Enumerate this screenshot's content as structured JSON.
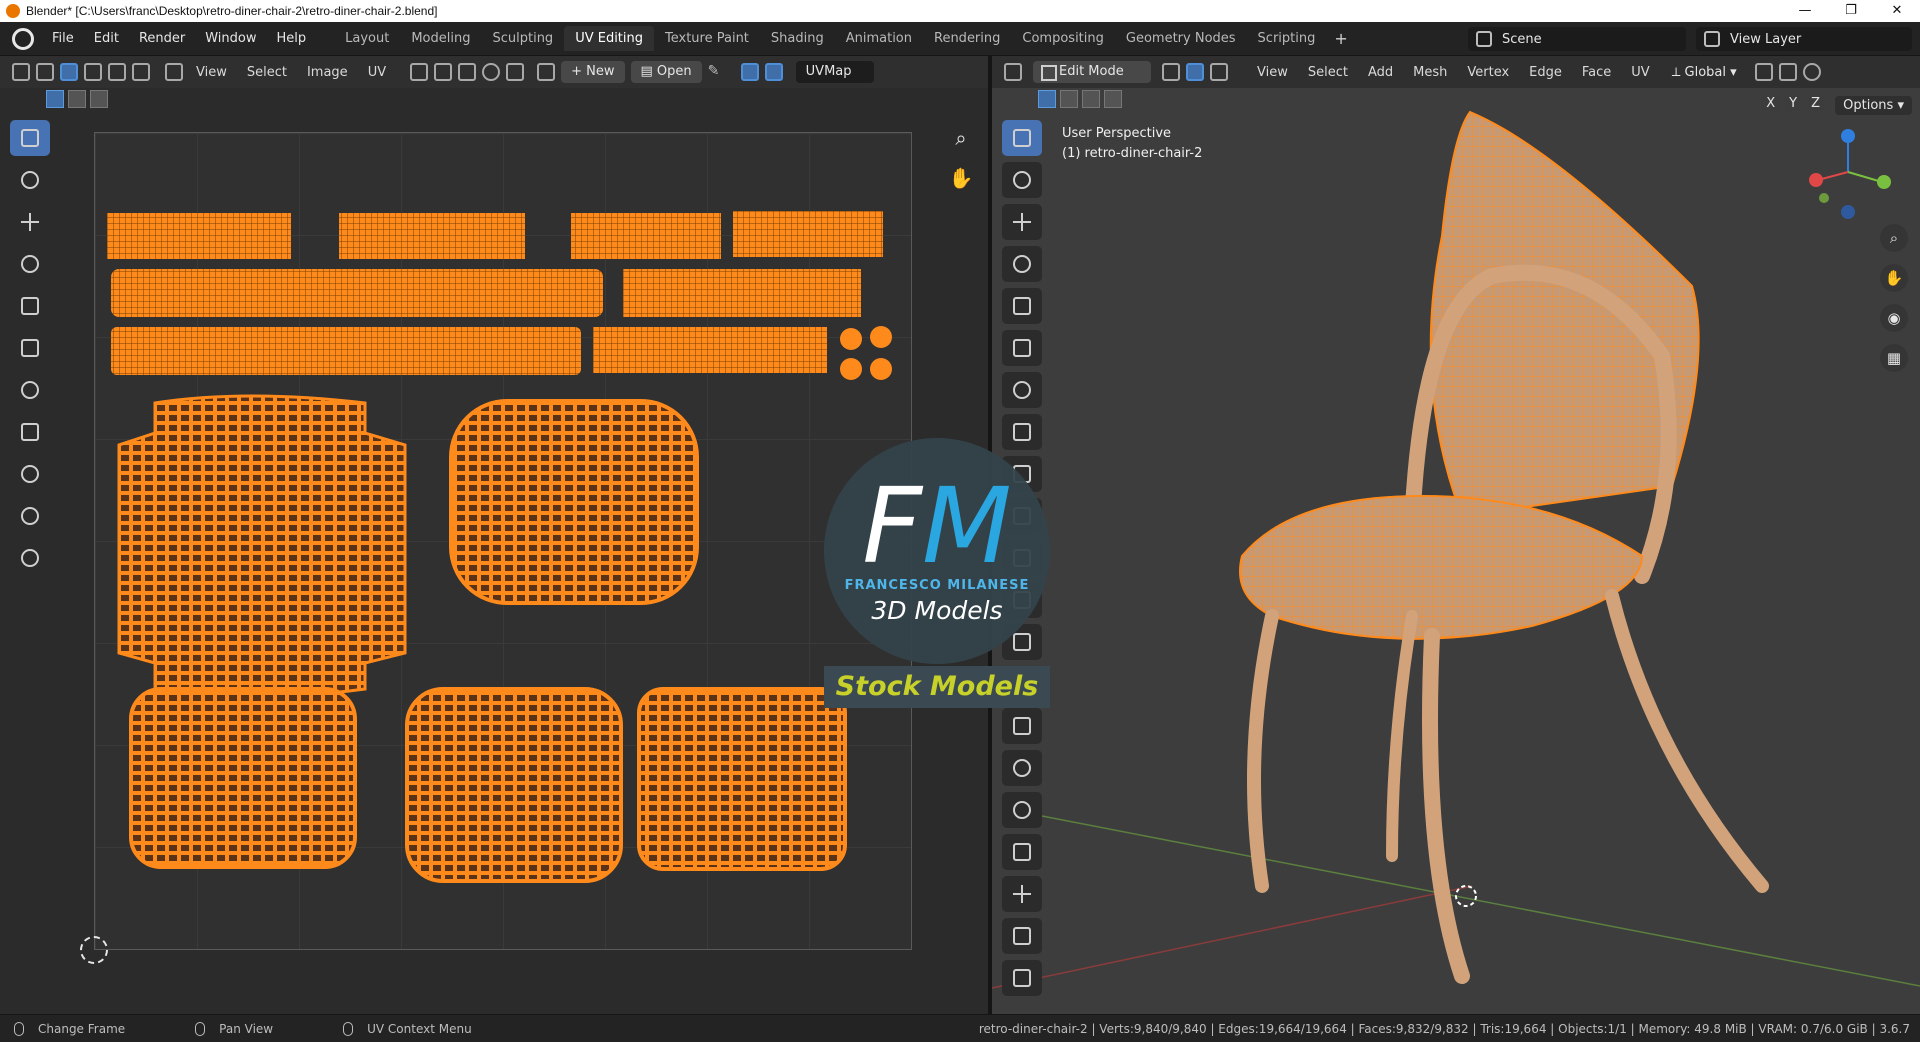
{
  "window": {
    "title": "Blender* [C:\\Users\\franc\\Desktop\\retro-diner-chair-2\\retro-diner-chair-2.blend]",
    "controls": [
      "—",
      "❐",
      "✕"
    ]
  },
  "menu": [
    "File",
    "Edit",
    "Render",
    "Window",
    "Help"
  ],
  "workspaces": {
    "tabs": [
      "Layout",
      "Modeling",
      "Sculpting",
      "UV Editing",
      "Texture Paint",
      "Shading",
      "Animation",
      "Rendering",
      "Compositing",
      "Geometry Nodes",
      "Scripting"
    ],
    "active": "UV Editing",
    "add_label": "+"
  },
  "scene": {
    "name": "Scene",
    "view_layer": "View Layer"
  },
  "uv_editor": {
    "menus": [
      "View",
      "Select",
      "Image",
      "UV"
    ],
    "new_label": "New",
    "open_label": "Open",
    "uvmap": "UVMap"
  },
  "viewport": {
    "mode": "Edit Mode",
    "menus": [
      "View",
      "Select",
      "Add",
      "Mesh",
      "Vertex",
      "Edge",
      "Face",
      "UV"
    ],
    "orientation": "Global",
    "options_label": "Options",
    "axes": [
      "X",
      "Y",
      "Z"
    ],
    "overlay_line1": "User Perspective",
    "overlay_line2": "(1) retro-diner-chair-2"
  },
  "watermark": {
    "letters_f": "F",
    "letters_m": "M",
    "author": "FRANCESCO MILANESE",
    "subtitle": "3D Models",
    "banner": "Stock Models"
  },
  "status": {
    "hints": [
      "Change Frame",
      "Pan View",
      "UV Context Menu"
    ],
    "stats": "retro-diner-chair-2 | Verts:9,840/9,840 | Edges:19,664/19,664 | Faces:9,832/9,832 | Tris:19,664 | Objects:1/1 | Memory: 49.8 MiB | VRAM: 0.7/6.0 GiB | 3.6.7"
  },
  "colors": {
    "uv_orange": "#ff8a1c",
    "accent_blue": "#4772b3",
    "wm_yellow": "#c7d12a"
  }
}
